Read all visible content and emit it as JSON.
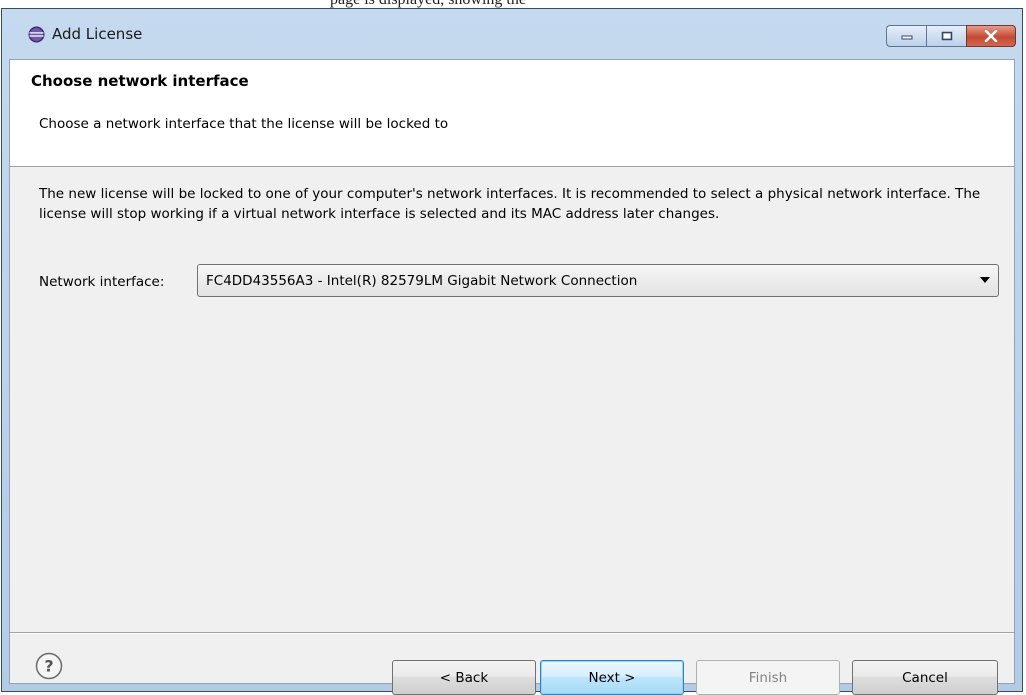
{
  "window": {
    "title": "Add License",
    "caption_above": "page is displayed, showing the"
  },
  "header": {
    "title": "Choose network interface",
    "description": "Choose a network interface that the license will be locked to"
  },
  "body": {
    "text": "The new license will be locked to one of your computer's network interfaces. It is recommended to select a physical network interface. The license will stop working if a virtual network interface is selected and its MAC address later changes.",
    "network_interface_label": "Network interface:",
    "network_interface_value": "FC4DD43556A3 - Intel(R) 82579LM Gigabit Network Connection"
  },
  "buttons": {
    "back": "< Back",
    "next": "Next >",
    "finish": "Finish",
    "cancel": "Cancel"
  },
  "icons": {
    "app": "eclipse-icon",
    "help": "help-icon",
    "minimize": "minimize-icon",
    "maximize": "maximize-icon",
    "close": "close-icon",
    "dropdown": "chevron-down-icon"
  }
}
